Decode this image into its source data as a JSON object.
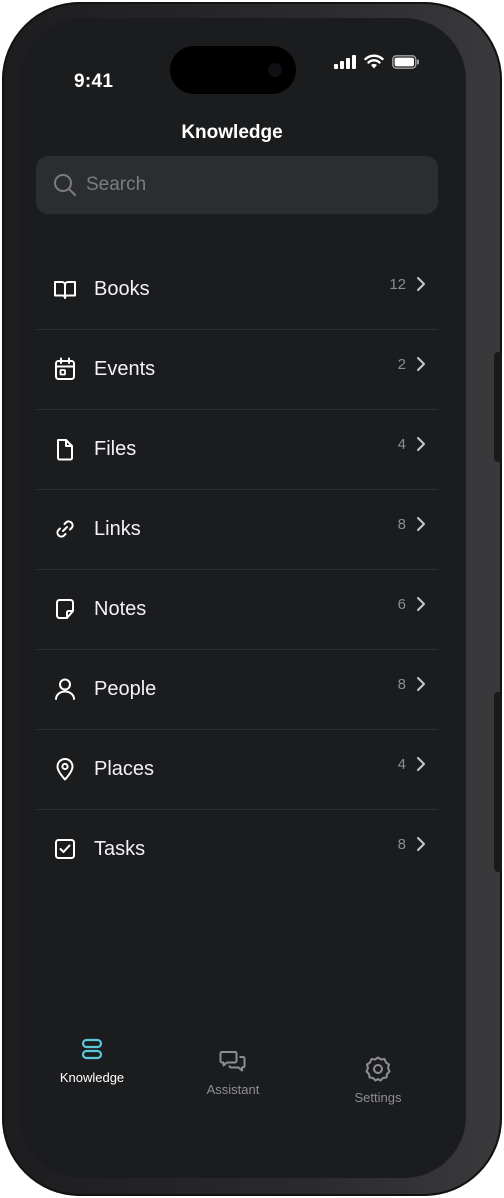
{
  "status_bar": {
    "time": "9:41",
    "icons": [
      "cellular-signal-icon",
      "wifi-icon",
      "battery-icon"
    ]
  },
  "header": {
    "title": "Knowledge"
  },
  "search": {
    "placeholder": "Search",
    "icon": "search-icon"
  },
  "list": {
    "items": [
      {
        "label": "Books",
        "count": "12",
        "icon": "book-icon"
      },
      {
        "label": "Events",
        "count": "2",
        "icon": "calendar-icon"
      },
      {
        "label": "Files",
        "count": "4",
        "icon": "file-icon"
      },
      {
        "label": "Links",
        "count": "8",
        "icon": "link-icon"
      },
      {
        "label": "Notes",
        "count": "6",
        "icon": "note-icon"
      },
      {
        "label": "People",
        "count": "8",
        "icon": "person-icon"
      },
      {
        "label": "Places",
        "count": "4",
        "icon": "map-pin-icon"
      },
      {
        "label": "Tasks",
        "count": "8",
        "icon": "checkbox-icon"
      }
    ]
  },
  "tabbar": {
    "tabs": [
      {
        "label": "Knowledge",
        "icon": "stack-icon",
        "active": true
      },
      {
        "label": "Assistant",
        "icon": "chat-bubbles-icon",
        "active": false
      },
      {
        "label": "Settings",
        "icon": "gear-icon",
        "active": false
      }
    ]
  },
  "colors": {
    "background": "#1b1c1e",
    "search_background": "#2c2d2f",
    "text_primary": "#f2f2f4",
    "text_secondary": "#8c8d91",
    "accent": "#5ac8d8"
  }
}
